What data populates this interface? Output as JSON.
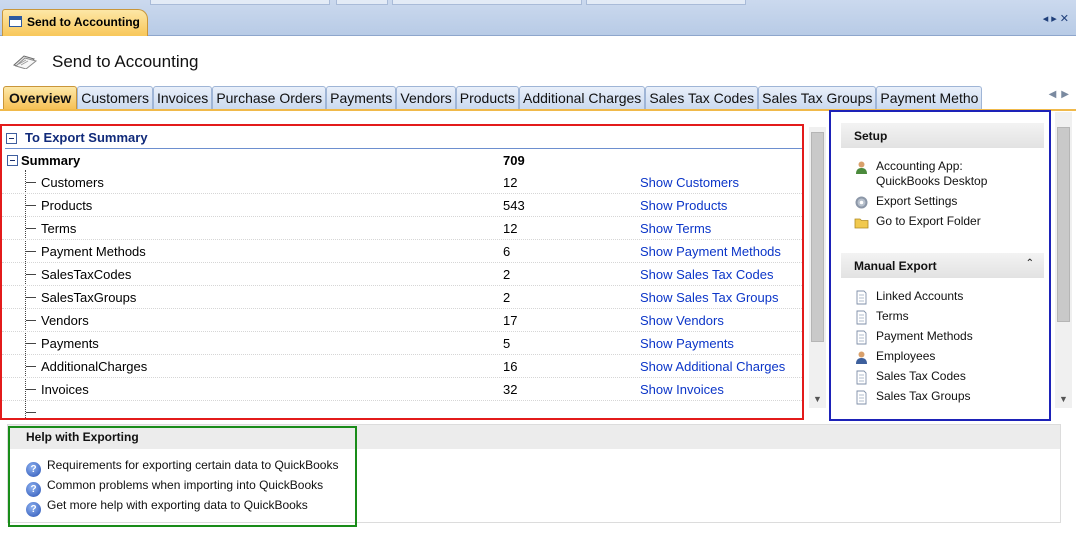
{
  "document_tab": {
    "title": "Send to Accounting"
  },
  "page": {
    "title": "Send to Accounting"
  },
  "tabs": [
    {
      "label": "Overview",
      "active": true
    },
    {
      "label": "Customers"
    },
    {
      "label": "Invoices"
    },
    {
      "label": "Purchase Orders"
    },
    {
      "label": "Payments"
    },
    {
      "label": "Vendors"
    },
    {
      "label": "Products"
    },
    {
      "label": "Additional Charges"
    },
    {
      "label": "Sales Tax Codes"
    },
    {
      "label": "Sales Tax Groups"
    },
    {
      "label": "Payment Metho"
    }
  ],
  "export_summary": {
    "section_title": "To Export Summary",
    "summary_label": "Summary",
    "summary_total": "709",
    "rows": [
      {
        "label": "Customers",
        "count": "12",
        "link": "Show Customers"
      },
      {
        "label": "Products",
        "count": "543",
        "link": "Show Products"
      },
      {
        "label": "Terms",
        "count": "12",
        "link": "Show Terms"
      },
      {
        "label": "Payment Methods",
        "count": "6",
        "link": "Show Payment Methods"
      },
      {
        "label": "SalesTaxCodes",
        "count": "2",
        "link": "Show Sales Tax Codes"
      },
      {
        "label": "SalesTaxGroups",
        "count": "2",
        "link": "Show Sales Tax Groups"
      },
      {
        "label": "Vendors",
        "count": "17",
        "link": "Show Vendors"
      },
      {
        "label": "Payments",
        "count": "5",
        "link": "Show Payments"
      },
      {
        "label": "AdditionalCharges",
        "count": "16",
        "link": "Show Additional Charges"
      },
      {
        "label": "Invoices",
        "count": "32",
        "link": "Show Invoices"
      }
    ]
  },
  "setup": {
    "title": "Setup",
    "items": [
      {
        "label": "Accounting App:",
        "sub": "QuickBooks Desktop",
        "icon": "user-icon"
      },
      {
        "label": "Export Settings",
        "icon": "gear-icon"
      },
      {
        "label": "Go to Export Folder",
        "icon": "folder-icon"
      }
    ]
  },
  "manual_export": {
    "title": "Manual Export",
    "items": [
      {
        "label": "Linked Accounts",
        "icon": "document-icon"
      },
      {
        "label": "Terms",
        "icon": "document-icon"
      },
      {
        "label": "Payment Methods",
        "icon": "document-icon"
      },
      {
        "label": "Employees",
        "icon": "user-icon"
      },
      {
        "label": "Sales Tax Codes",
        "icon": "document-icon"
      },
      {
        "label": "Sales Tax Groups",
        "icon": "document-icon"
      }
    ]
  },
  "help": {
    "title": "Help with Exporting",
    "links": [
      "Requirements for exporting certain data to QuickBooks",
      "Common problems when importing into QuickBooks",
      "Get more help with exporting data to QuickBooks"
    ]
  },
  "colors": {
    "active_tab": "#f6bf52",
    "link": "#0b35c8",
    "export_panel_border": "#e31b1b",
    "side_panel_border": "#1d22b8",
    "help_panel_border": "#198c19"
  }
}
